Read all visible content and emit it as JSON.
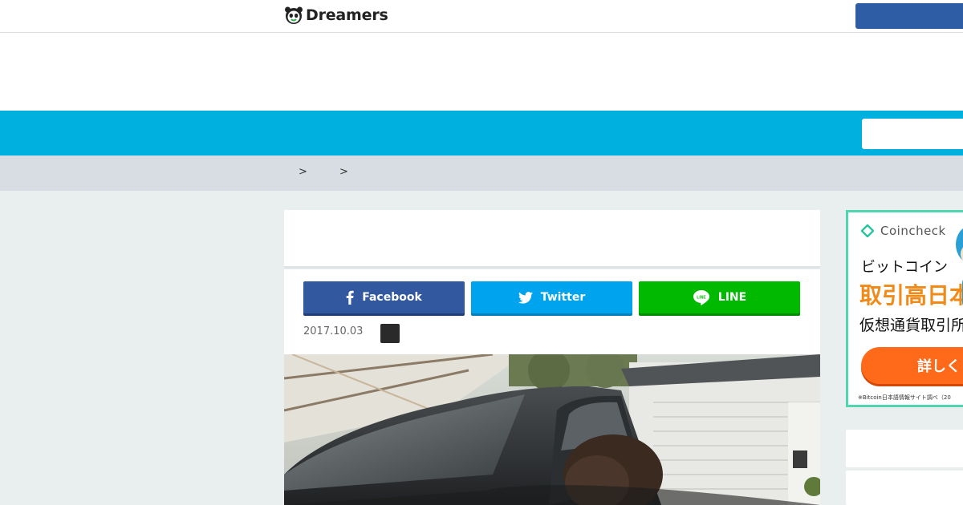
{
  "header": {
    "logo_text": "Dreamers",
    "logo_icon": "panda-icon",
    "header_button_label": ""
  },
  "nav": {
    "search_placeholder": ""
  },
  "breadcrumb": {
    "separators": [
      ">",
      ">"
    ]
  },
  "article": {
    "share": {
      "facebook_label": "Facebook",
      "twitter_label": "Twitter",
      "line_label": "LINE"
    },
    "date": "2017.10.03",
    "hero_alt": "Person leaning into a dark car parked beside a house"
  },
  "sidebar": {
    "ad": {
      "brand": "Coincheck",
      "line1": "ビットコイン",
      "line2": "取引高日本",
      "line3": "仮想通貨取引所",
      "cta": "詳しく",
      "note": "※Bitcoin日本語情報サイト調べ（20"
    }
  },
  "colors": {
    "nav_cyan": "#00b1e0",
    "facebook_blue": "#3258a0",
    "twitter_blue": "#00a3ed",
    "line_green": "#00b900",
    "coincheck_teal": "#4fd6b0",
    "cta_orange": "#ff6a1a"
  }
}
